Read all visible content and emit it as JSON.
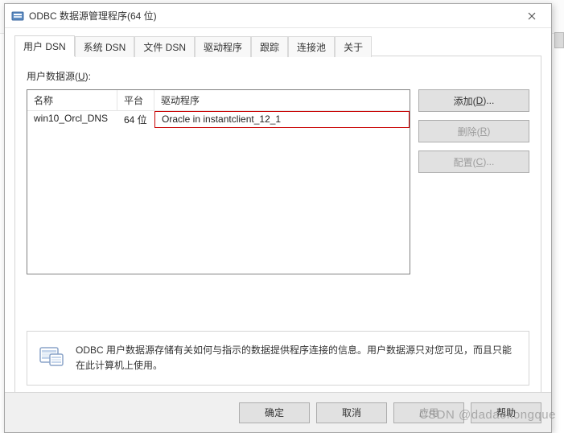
{
  "window": {
    "title": "ODBC 数据源管理程序(64 位)"
  },
  "tabs": [
    {
      "label": "用户 DSN"
    },
    {
      "label": "系统 DSN"
    },
    {
      "label": "文件 DSN"
    },
    {
      "label": "驱动程序"
    },
    {
      "label": "跟踪"
    },
    {
      "label": "连接池"
    },
    {
      "label": "关于"
    }
  ],
  "panel": {
    "listLabel": "用户数据源(",
    "listAccel": "U",
    "listLabelSuffix": "):",
    "columns": {
      "name": "名称",
      "platform": "平台",
      "driver": "驱动程序"
    },
    "rows": [
      {
        "name": "win10_Orcl_DNS",
        "platform": "64 位",
        "driver": "Oracle in instantclient_12_1"
      }
    ]
  },
  "buttons": {
    "add": {
      "label": "添加(",
      "accel": "D",
      "suffix": ")..."
    },
    "remove": {
      "label": "删除(",
      "accel": "R",
      "suffix": ")"
    },
    "configure": {
      "label": "配置(",
      "accel": "C",
      "suffix": ")..."
    }
  },
  "infoText": "ODBC 用户数据源存储有关如何与指示的数据提供程序连接的信息。用户数据源只对您可见，而且只能在此计算机上使用。",
  "dialogButtons": {
    "ok": "确定",
    "cancel": "取消",
    "apply": "应用",
    "help": "帮助"
  },
  "watermark": "CSDN @dadaokongque"
}
